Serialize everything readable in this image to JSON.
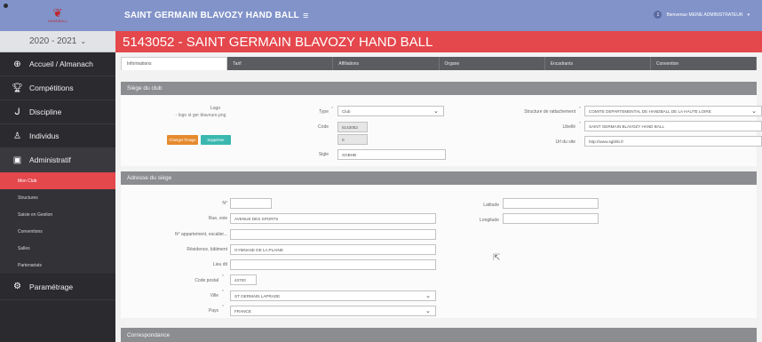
{
  "sidebar": {
    "logo_text": "HANDBALL",
    "season": "2020 - 2021",
    "nav": [
      {
        "label": "Accueil / Almanach",
        "icon": "globe"
      },
      {
        "label": "Compétitions",
        "icon": "trophy"
      },
      {
        "label": "Discipline",
        "icon": "whistle"
      },
      {
        "label": "Individus",
        "icon": "user"
      },
      {
        "label": "Administratif",
        "icon": "folder"
      }
    ],
    "sub_items": [
      "Mon Club",
      "Structures",
      "Saisie en Gestion",
      "Conventions",
      "Salles",
      "Partenariats"
    ],
    "settings_label": "Paramétrage"
  },
  "topbar": {
    "club_name": "SAINT GERMAIN BLAVOZY HAND BALL",
    "user_initial": "1",
    "user_label": "Bienvenue MEINE ADMINISTRATEUR"
  },
  "title": "5143052 - SAINT GERMAIN BLAVOZY HAND BALL",
  "tabs": [
    "Informations",
    "Tarif",
    "Affiliations",
    "Organe",
    "Encadrants",
    "Convention"
  ],
  "siege": {
    "header": "Siège du club",
    "logo_label": "Logo",
    "logo_alt": "logo st ger blavoure.png",
    "btn_change": "Changer l'image",
    "btn_delete": "Supprimer",
    "type_label": "Type",
    "type_value": "Club",
    "code_label": "Code",
    "code_value": "5143052",
    "code2_value": "0",
    "sigle_label": "Sigle",
    "sigle_value": "SGBHB",
    "structure_label": "Structure de rattachement",
    "structure_value": "COMITE DEPARTEMENTAL DE HANDBALL DE LA HAUTE LOIRE",
    "libelle_label": "Libellé",
    "libelle_value": "SAINT GERMAIN BLAVOZY HAND BALL",
    "url_label": "Url du site",
    "url_value": "http://www.sgbhb.fr"
  },
  "adresse": {
    "header": "Adresse du siège",
    "num_label": "N°",
    "num_value": "",
    "rue_label": "Rue, voie",
    "rue_value": "AVENUE DES SPORTS",
    "appart_label": "N° appartement, escalier...",
    "appart_value": "",
    "residence_label": "Résidence, bâtiment",
    "residence_value": "GYMNASE DE LA PLAINE",
    "lieu_label": "Lieu dit",
    "lieu_value": "",
    "cp_label": "Code postal",
    "cp_value": "43700",
    "ville_label": "Ville",
    "ville_value": "ST GERMAIN LAPRADE",
    "pays_label": "Pays",
    "pays_value": "FRANCE",
    "lat_label": "Latitude",
    "lat_value": "",
    "long_label": "Longitude",
    "long_value": ""
  },
  "correspondance_header": "Correspondance",
  "colors": {
    "accent_blue": "#8193c9",
    "accent_red": "#e4474c",
    "sidebar": "#2b2b2f"
  }
}
